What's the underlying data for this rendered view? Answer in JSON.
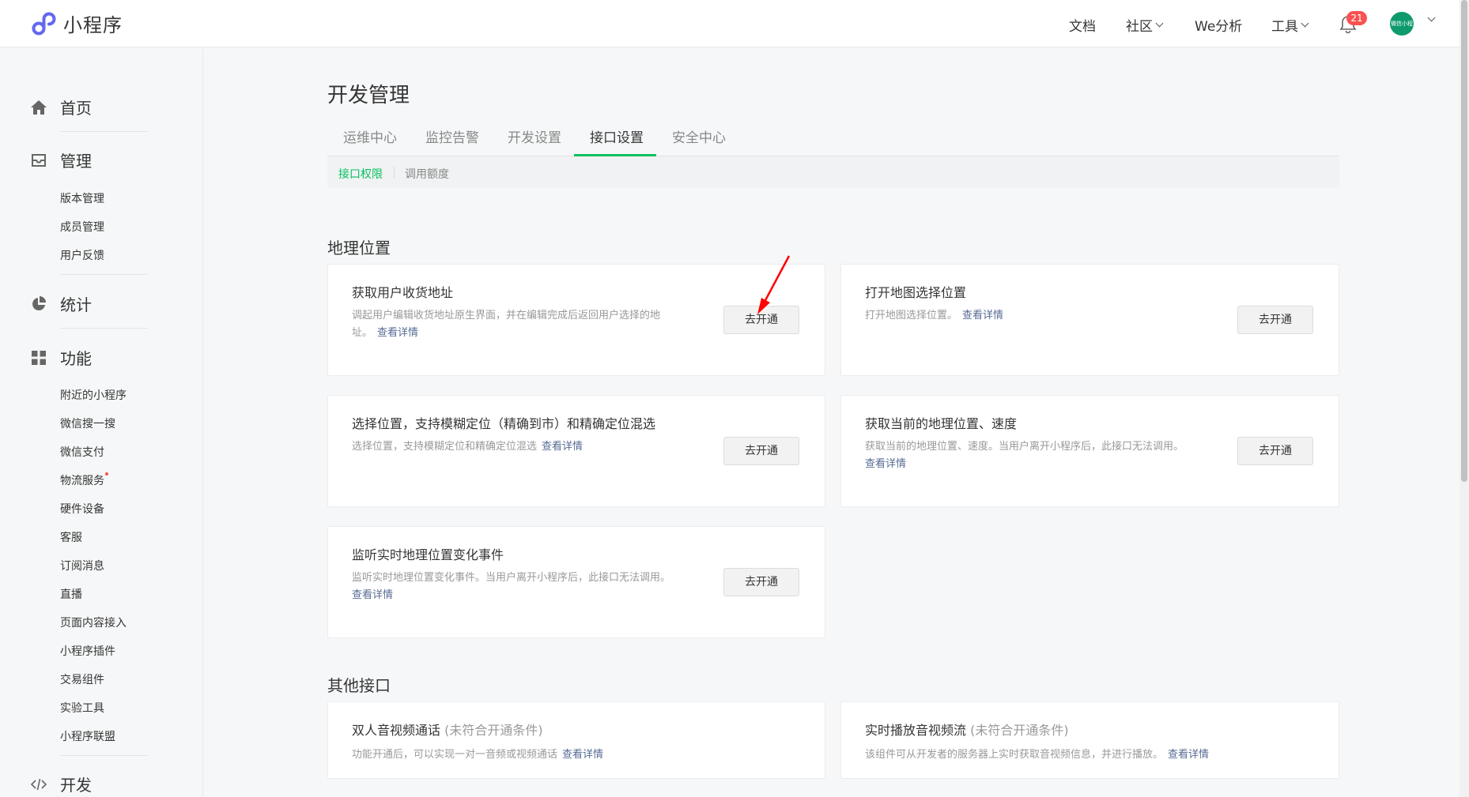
{
  "app": {
    "title": "小程序"
  },
  "topnav": {
    "docs": "文档",
    "community": "社区",
    "analytics": "We分析",
    "tools": "工具",
    "notification_count": "21",
    "avatar_text": "微信小程序"
  },
  "sidebar": {
    "home": "首页",
    "manage": "管理",
    "manage_items": [
      "版本管理",
      "成员管理",
      "用户反馈"
    ],
    "stats": "统计",
    "features": "功能",
    "feature_items": [
      "附近的小程序",
      "微信搜一搜",
      "微信支付",
      "物流服务",
      "硬件设备",
      "客服",
      "订阅消息",
      "直播",
      "页面内容接入",
      "小程序插件",
      "交易组件",
      "实验工具",
      "小程序联盟"
    ],
    "develop": "开发"
  },
  "main": {
    "page_title": "开发管理",
    "tabs": [
      "运维中心",
      "监控告警",
      "开发设置",
      "接口设置",
      "安全中心"
    ],
    "active_tab": "接口设置",
    "subtabs": [
      "接口权限",
      "调用额度"
    ],
    "active_subtab": "接口权限"
  },
  "sections": {
    "geo": {
      "title": "地理位置",
      "cards": [
        {
          "title": "获取用户收货地址",
          "desc_line1": "调起用户编辑收货地址原生界面，并在编辑完成后返回用户选择的地",
          "desc_line2": "址。",
          "link": "查看详情",
          "button": "去开通"
        },
        {
          "title": "打开地图选择位置",
          "desc_line1": "打开地图选择位置。",
          "link": "查看详情",
          "button": "去开通"
        },
        {
          "title": "选择位置，支持模糊定位（精确到市）和精确定位混选",
          "desc_line1": "选择位置，支持模糊定位和精确定位混选",
          "link": "查看详情",
          "button": "去开通"
        },
        {
          "title": "获取当前的地理位置、速度",
          "desc_line1": "获取当前的地理位置、速度。当用户离开小程序后，此接口无法调用。",
          "link": "查看详情",
          "button": "去开通"
        },
        {
          "title": "监听实时地理位置变化事件",
          "desc_line1": "监听实时地理位置变化事件。当用户离开小程序后，此接口无法调用。",
          "link": "查看详情",
          "button": "去开通"
        }
      ]
    },
    "other": {
      "title": "其他接口",
      "cards": [
        {
          "title": "双人音视频通话",
          "status": "(未符合开通条件)",
          "desc_line1": "功能开通后，可以实现一对一音频或视频通话",
          "link": "查看详情"
        },
        {
          "title": "实时播放音视频流",
          "status": "(未符合开通条件)",
          "desc_line1": "该组件可从开发者的服务器上实时获取音视频信息，并进行播放。",
          "link": "查看详情"
        }
      ]
    }
  },
  "colors": {
    "accent": "#07c160",
    "link": "#576b95",
    "badge": "#fa5151",
    "arrow": "#ff0000"
  }
}
